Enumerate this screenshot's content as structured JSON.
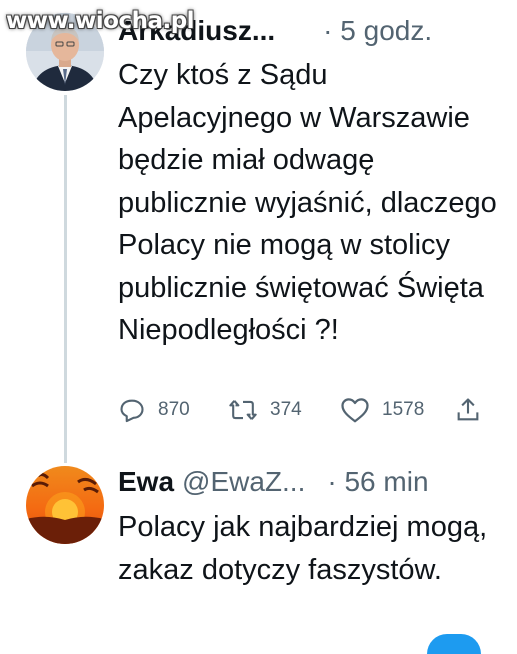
{
  "watermark": "www.wiocha.pl",
  "tweet1": {
    "author": "Arkadiusz...",
    "time": "· 5 godz.",
    "text": "Czy ktoś z Sądu Apelacyjnego w Warszawie będzie miał odwagę publicznie wyjaśnić, dlaczego Polacy nie mogą w stolicy publicznie świętować Święta Niepodległości ?!",
    "replies": "870",
    "retweets": "374",
    "likes": "1578"
  },
  "tweet2": {
    "author": "Ewa",
    "handle": "@EwaZ...",
    "time": "· 56 min",
    "text": "Polacy jak najbardziej mogą, zakaz dotyczy faszystów."
  },
  "icons": {
    "reply": "reply-icon",
    "retweet": "retweet-icon",
    "like": "heart-icon",
    "share": "share-icon"
  },
  "colors": {
    "text": "#0f1419",
    "muted": "#536471",
    "thread_line": "#cfd9de",
    "accent": "#1d9bf0"
  }
}
